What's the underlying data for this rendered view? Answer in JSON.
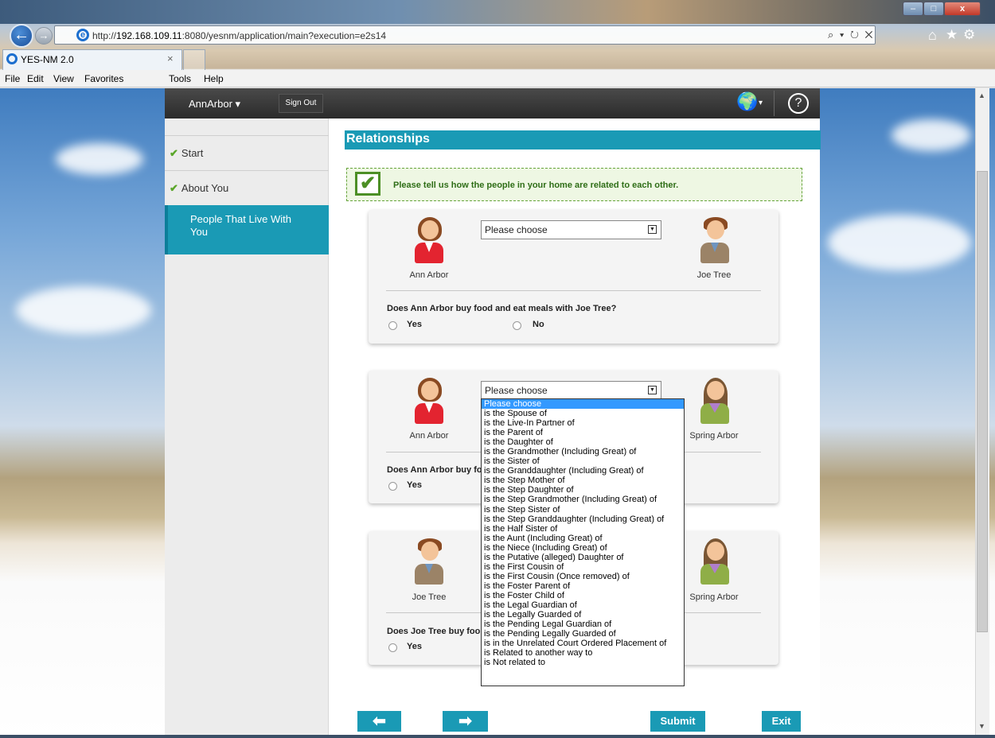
{
  "window": {
    "minimize": "–",
    "maximize": "□",
    "close": "x"
  },
  "browser": {
    "url_prefix": "http://",
    "url_host": "192.168.109.11",
    "url_rest": ":8080/yesnm/application/main?execution=e2s14",
    "addr_tools": "⌕ ▾ ↻ ✕",
    "tab_title": "YES-NM 2.0",
    "tab_close": "×",
    "menu": [
      {
        "label": "File"
      },
      {
        "label": "Edit"
      },
      {
        "label": "View"
      },
      {
        "label": "Favorites"
      },
      {
        "label": "Tools"
      },
      {
        "label": "Help"
      }
    ]
  },
  "app": {
    "user": "AnnArbor",
    "user_caret": "▾",
    "signout": "Sign Out",
    "help": "?",
    "globe": "🌍",
    "globe_caret": "▾",
    "sidebar": [
      {
        "label": "Start",
        "done": true
      },
      {
        "label": "About You",
        "done": true
      },
      {
        "label": "People That Live With You",
        "active": true
      }
    ],
    "check_mark": "✔",
    "section_title": "Relationships",
    "info_text": "Please tell us how the people in your home are related to each other.",
    "info_icon": "✔",
    "yes": "Yes",
    "no": "No",
    "cards": [
      {
        "left": "Ann Arbor",
        "right": "Joe Tree",
        "select": "Please choose",
        "question": "Does Ann Arbor buy food and eat meals with Joe Tree?"
      },
      {
        "left": "Ann Arbor",
        "right": "Spring Arbor",
        "select": "Please choose",
        "question": "Does Ann Arbor buy fo"
      },
      {
        "left": "Joe Tree",
        "right": "Spring Arbor",
        "select": "",
        "question": "Does Joe Tree buy foo"
      }
    ],
    "dropdown_options": [
      "Please choose",
      "is the Spouse of",
      "is the Live-In Partner of",
      "is the Parent of",
      "is the Daughter of",
      "is the Grandmother (Including Great) of",
      "is the Sister of",
      "is the Granddaughter (Including Great) of",
      "is the Step Mother of",
      "is the Step Daughter of",
      "is the Step Grandmother (Including Great) of",
      "is the Step Sister of",
      "is the Step Granddaughter (Including Great) of",
      "is the Half Sister of",
      "is the Aunt (Including Great) of",
      "is the Niece (Including Great) of",
      "is the Putative (alleged) Daughter of",
      "is the First Cousin of",
      "is the First Cousin (Once removed) of",
      "is the Foster Parent of",
      "is the Foster Child of",
      "is the Legal Guardian of",
      "is the Legally Guarded of",
      "is the Pending Legal Guardian of",
      "is the Pending Legally Guarded of",
      "is in the Unrelated Court Ordered Placement of",
      "is Related to another way to",
      "is Not related to"
    ],
    "buttons": {
      "prev": "🠐",
      "next": "🠒",
      "submit": "Submit",
      "exit": "Exit"
    },
    "colors": {
      "accent": "#1a9ab5",
      "check": "#5aa629",
      "info_bg": "#eef7e3"
    }
  }
}
